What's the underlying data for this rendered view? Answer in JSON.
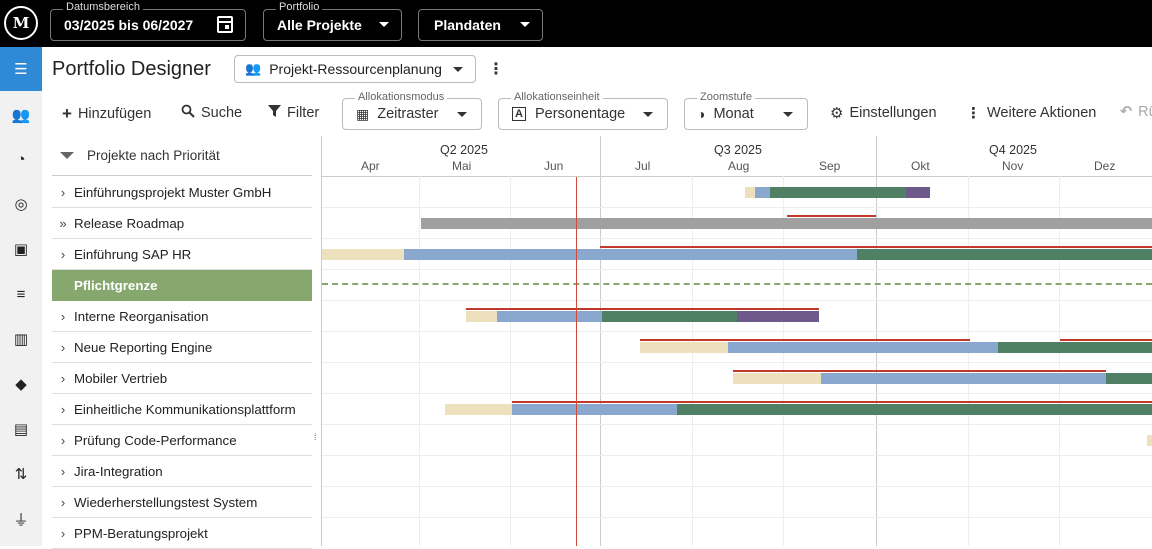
{
  "topbar": {
    "logo": "M",
    "date_range": {
      "legend": "Datumsbereich",
      "value": "03/2025 bis 06/2027"
    },
    "portfolio": {
      "legend": "Portfolio",
      "value": "Alle Projekte"
    },
    "data_mode": {
      "value": "Plandaten"
    }
  },
  "rail": {
    "items": [
      {
        "icon": "menu-icon",
        "glyph": "☰",
        "active": true
      },
      {
        "icon": "users-icon",
        "glyph": "👥"
      },
      {
        "icon": "pie-chart-icon",
        "glyph": "◔"
      },
      {
        "icon": "target-icon",
        "glyph": "◎"
      },
      {
        "icon": "badge-icon",
        "glyph": "▣"
      },
      {
        "icon": "list-icon",
        "glyph": "≡"
      },
      {
        "icon": "columns-icon",
        "glyph": "▥"
      },
      {
        "icon": "direction-icon",
        "glyph": "◆"
      },
      {
        "icon": "document-icon",
        "glyph": "▤"
      },
      {
        "icon": "sort-icon",
        "glyph": "⇅"
      },
      {
        "icon": "plug-icon",
        "glyph": "⏚"
      }
    ]
  },
  "header": {
    "title": "Portfolio Designer",
    "view_select": "Projekt-Ressourcenplanung"
  },
  "toolbar": {
    "add": "Hinzufügen",
    "search": "Suche",
    "filter": "Filter",
    "allocation_mode": {
      "legend": "Allokationsmodus",
      "value": "Zeitraster"
    },
    "allocation_unit": {
      "legend": "Allokationseinheit",
      "value": "Personentage"
    },
    "zoom": {
      "legend": "Zoomstufe",
      "value": "Monat"
    },
    "settings": "Einstellungen",
    "more": "Weitere Aktionen",
    "undo": "Rü"
  },
  "tree": {
    "header": "Projekte nach Priorität",
    "rows": [
      {
        "label": "Einführungsprojekt Muster GmbH",
        "chev": "›"
      },
      {
        "label": "Release Roadmap",
        "chev": "»"
      },
      {
        "label": "Einführung SAP HR",
        "chev": "›"
      },
      {
        "label": "Pflichtgrenze",
        "chev": "",
        "band": true
      },
      {
        "label": "Interne Reorganisation",
        "chev": "›"
      },
      {
        "label": "Neue Reporting Engine",
        "chev": "›"
      },
      {
        "label": "Mobiler Vertrieb",
        "chev": "›"
      },
      {
        "label": "Einheitliche Kommunikationsplattform",
        "chev": "›"
      },
      {
        "label": "Prüfung Code-Performance",
        "chev": "›"
      },
      {
        "label": "Jira-Integration",
        "chev": "›"
      },
      {
        "label": "Wiederherstellungstest System",
        "chev": "›"
      },
      {
        "label": "PPM-Beratungsprojekt",
        "chev": "›"
      }
    ]
  },
  "timeline": {
    "quarters": [
      "Q2 2025",
      "Q3 2025",
      "Q4 2025"
    ],
    "months": [
      "Apr",
      "Mai",
      "Jun",
      "Jul",
      "Aug",
      "Sep",
      "Okt",
      "Nov",
      "Dez"
    ],
    "colors": {
      "cream": "#ece0bd",
      "blue": "#8aa7d0",
      "green": "#4f8063",
      "purple": "#6d5a8a",
      "gray": "#a0a0a0",
      "red": "#c0392b"
    }
  }
}
